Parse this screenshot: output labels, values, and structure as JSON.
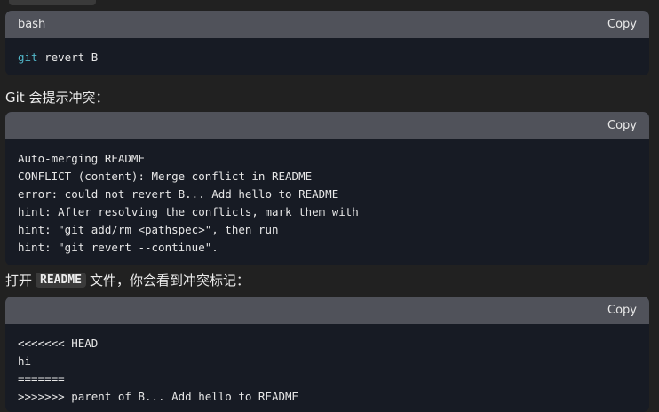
{
  "blocks": [
    {
      "lang": "bash",
      "copy_label": "Copy",
      "cmd": "git",
      "cmd_rest": " revert B"
    },
    {
      "intro": "Git 会提示冲突：",
      "lang": "",
      "copy_label": "Copy",
      "code": "Auto-merging README\nCONFLICT (content): Merge conflict in README\nerror: could not revert B... Add hello to README\nhint: After resolving the conflicts, mark them with\nhint: \"git add/rm <pathspec>\", then run\nhint: \"git revert --continue\"."
    },
    {
      "intro_before": "打开",
      "intro_code": "README",
      "intro_after": "文件，你会看到冲突标记：",
      "lang": "",
      "copy_label": "Copy",
      "code": "<<<<<<< HEAD\nhi\n=======\n>>>>>>> parent of B... Add hello to README"
    }
  ]
}
